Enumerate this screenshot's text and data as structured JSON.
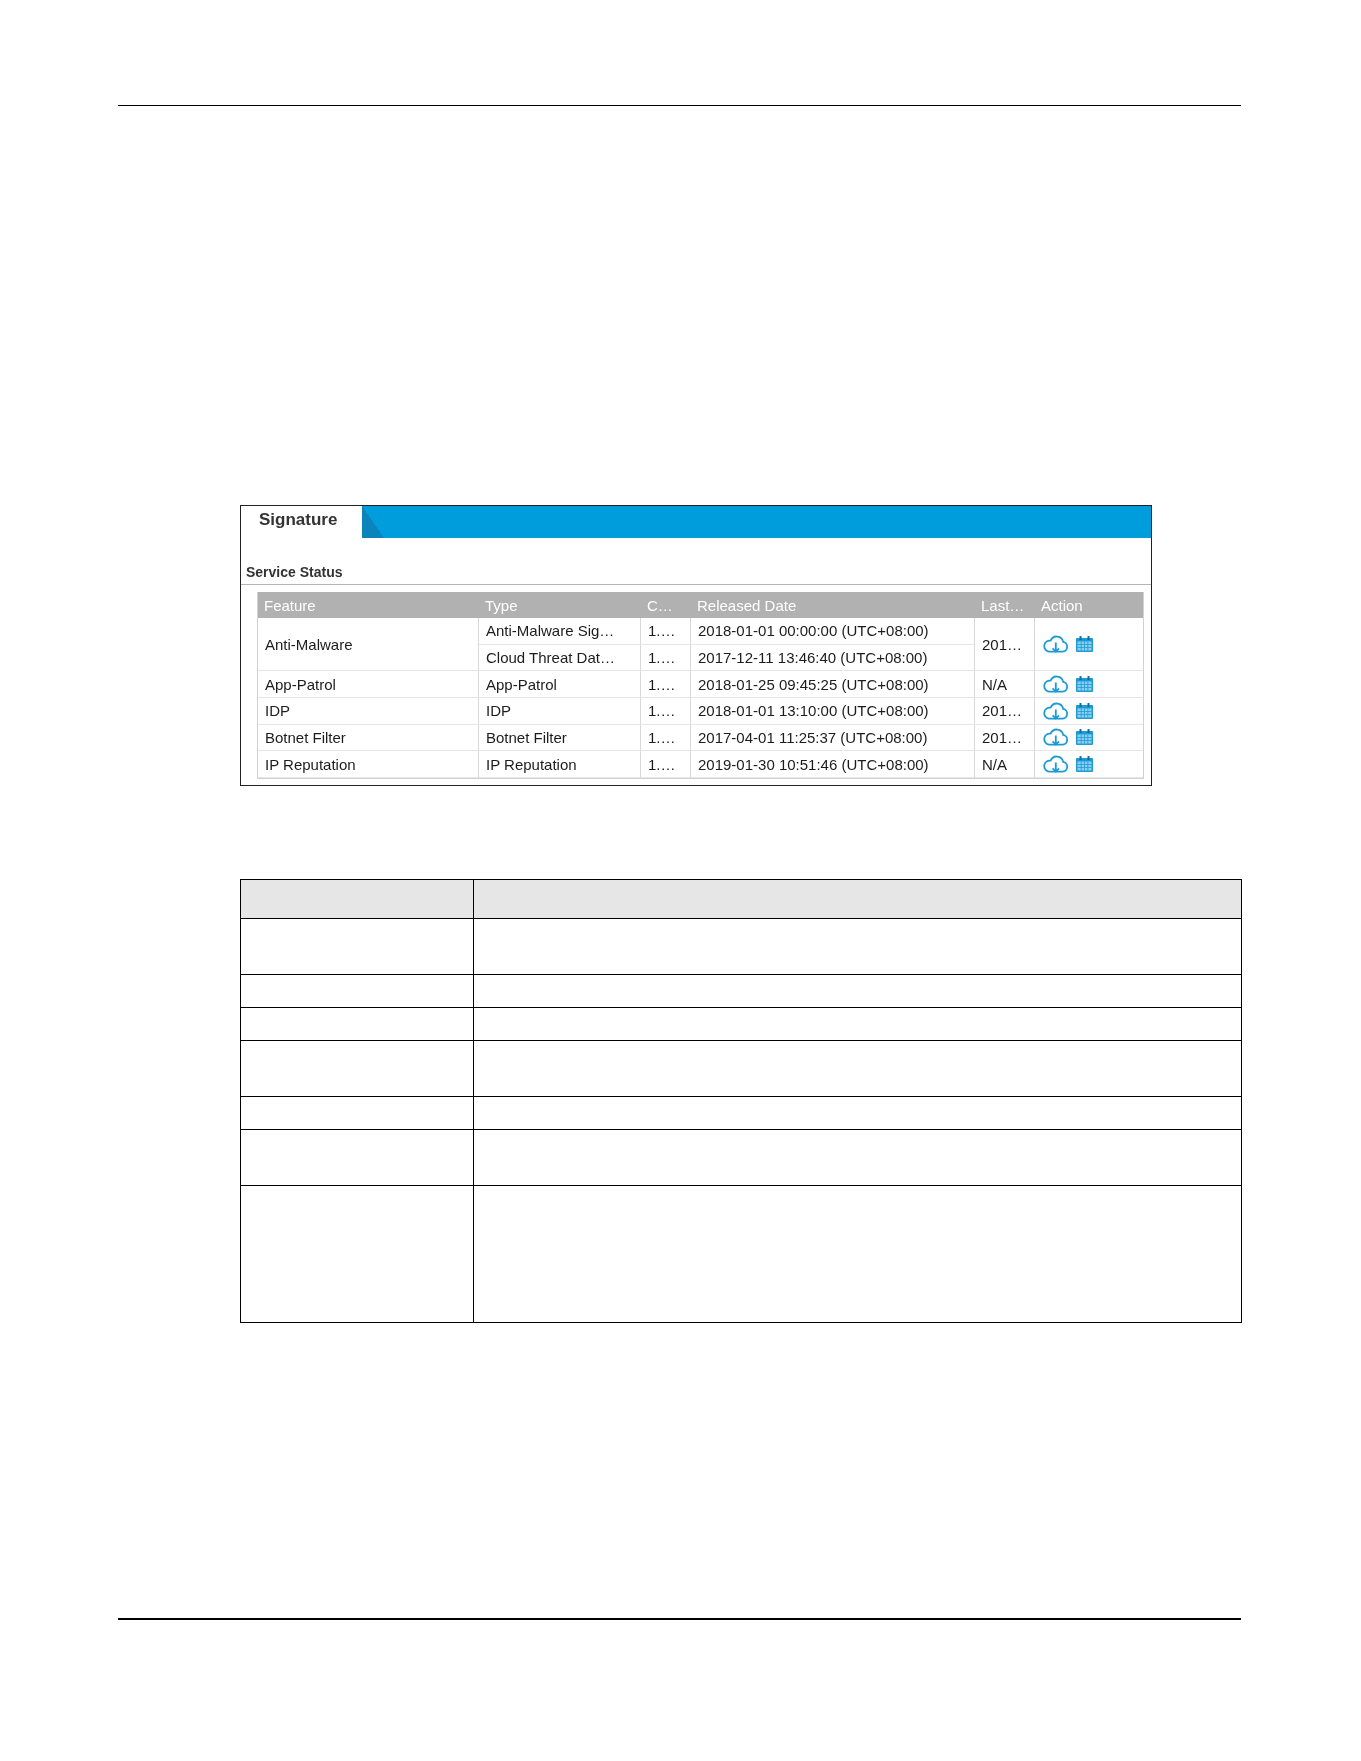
{
  "tabs": [
    {
      "label": "Signature",
      "selected": true
    }
  ],
  "section": {
    "title": "Service Status"
  },
  "table": {
    "columns": [
      "Feature",
      "Type",
      "C…",
      "Released Date",
      "Last…",
      "Action"
    ],
    "rows": [
      {
        "feature": "Anti-Malware",
        "signatures": [
          {
            "type": "Anti-Malware Sig…",
            "column_3": "1.…",
            "released_date": "2018-01-01 00:00:00 (UTC+08:00)"
          },
          {
            "type": "Cloud Threat Dat…",
            "column_3": "1.…",
            "released_date": "2017-12-11 13:46:40 (UTC+08:00)"
          }
        ],
        "column_5": "201…"
      },
      {
        "feature": "App-Patrol",
        "signatures": [
          {
            "type": "App-Patrol",
            "column_3": "1.…",
            "released_date": "2018-01-25 09:45:25 (UTC+08:00)"
          }
        ],
        "column_5": "N/A"
      },
      {
        "feature": "IDP",
        "signatures": [
          {
            "type": "IDP",
            "column_3": "1.…",
            "released_date": "2018-01-01 13:10:00 (UTC+08:00)"
          }
        ],
        "column_5": "201…"
      },
      {
        "feature": "Botnet Filter",
        "signatures": [
          {
            "type": "Botnet Filter",
            "column_3": "1.…",
            "released_date": "2017-04-01 11:25:37 (UTC+08:00)"
          }
        ],
        "column_5": "201…"
      },
      {
        "feature": "IP Reputation",
        "signatures": [
          {
            "type": "IP Reputation",
            "column_3": "1.…",
            "released_date": "2019-01-30 10:51:46 (UTC+08:00)"
          }
        ],
        "column_5": "N/A"
      }
    ]
  }
}
